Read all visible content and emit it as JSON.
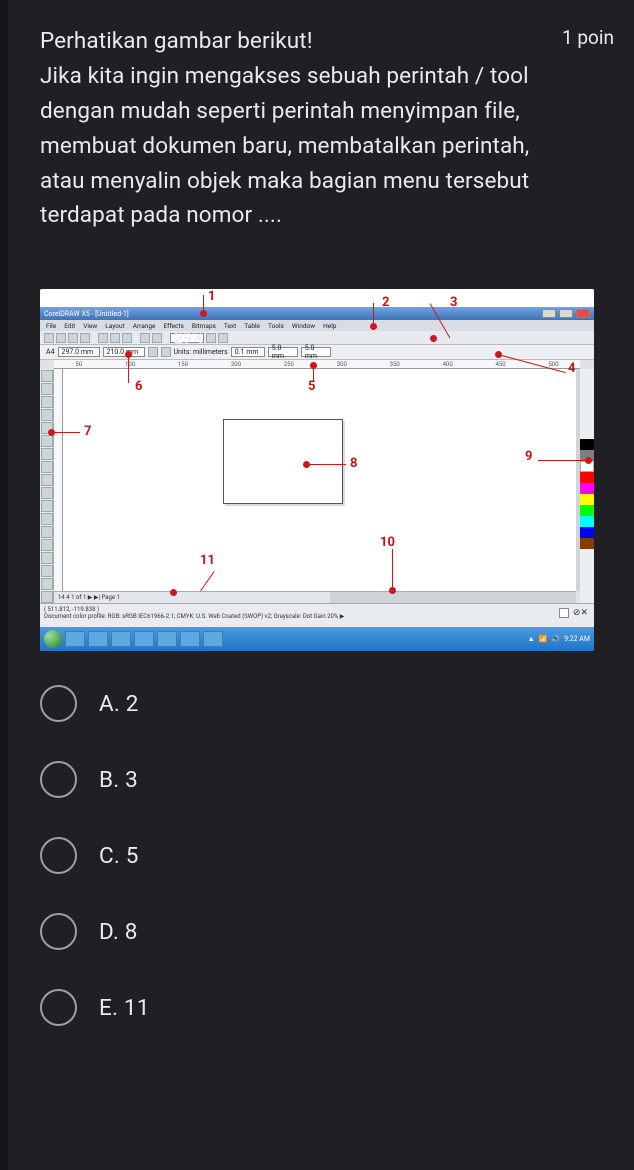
{
  "points_label": "1 poin",
  "question": "Perhatikan gambar berikut!\nJika kita ingin mengakses sebuah perintah / tool dengan mudah seperti perintah menyimpan file, membuat dokumen baru, membatalkan perintah, atau menyalin objek maka bagian menu tersebut terdapat pada nomor ....",
  "screenshot": {
    "title": "CorelDRAW X5 - [Untitled-1]",
    "menu": [
      "File",
      "Edit",
      "View",
      "Layout",
      "Arrange",
      "Effects",
      "Bitmaps",
      "Text",
      "Table",
      "Tools",
      "Window",
      "Help"
    ],
    "prop_w": "297.0 mm",
    "prop_h": "210.0 mm",
    "units": "Units: millimeters",
    "nudge": "0.1 mm",
    "dup_x": "5.0 mm",
    "dup_y": "5.0 mm",
    "ruler_ticks": [
      "50",
      "100",
      "150",
      "200",
      "250",
      "300",
      "350",
      "400",
      "450",
      "500"
    ],
    "page_tabs": "14 4  1 of 1  ▶ ▶| Page 1",
    "status1": "( 511.812, -119.838 )",
    "status2": "Document color profile: RGB: sRGB IEC61966-2.1; CMYK: U.S. Web Coated (SWOP) v2; Grayscale: Dot Gain 20% ▶",
    "tray_time": "9:22 AM",
    "annotations": {
      "1": "1",
      "2": "2",
      "3": "3",
      "4": "4",
      "5": "5",
      "6": "6",
      "7": "7",
      "8": "8",
      "9": "9",
      "10": "10",
      "11": "11"
    },
    "palette": [
      "#000000",
      "#7f7f7f",
      "#ffffff",
      "#ff0000",
      "#ff00ff",
      "#ffff00",
      "#00ff00",
      "#00ffff",
      "#0000ff",
      "#7f3f00"
    ]
  },
  "options": [
    {
      "key": "a",
      "label": "A. 2"
    },
    {
      "key": "b",
      "label": "B. 3"
    },
    {
      "key": "c",
      "label": "C. 5"
    },
    {
      "key": "d",
      "label": "D. 8"
    },
    {
      "key": "e",
      "label": "E. 11"
    }
  ]
}
